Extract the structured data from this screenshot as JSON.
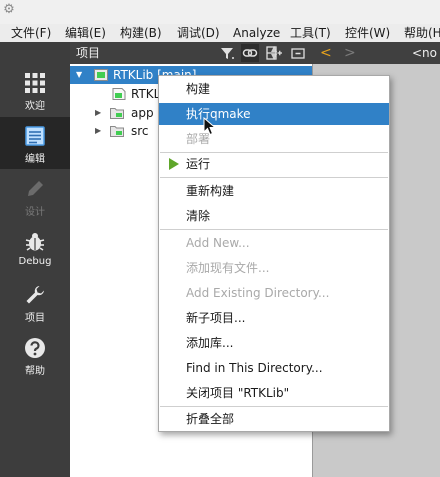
{
  "menubar": {
    "items": [
      "文件(F)",
      "编辑(E)",
      "构建(B)",
      "调试(D)",
      "Analyze",
      "工具(T)",
      "控件(W)",
      "帮助(H)"
    ]
  },
  "modes": [
    {
      "label": "欢迎",
      "icon": "grid-icon",
      "active": false,
      "enabled": true
    },
    {
      "label": "编辑",
      "icon": "document-icon",
      "active": true,
      "enabled": true
    },
    {
      "label": "设计",
      "icon": "pencil-icon",
      "active": false,
      "enabled": false
    },
    {
      "label": "Debug",
      "icon": "bug-icon",
      "active": false,
      "enabled": true
    },
    {
      "label": "项目",
      "icon": "wrench-icon",
      "active": false,
      "enabled": true
    },
    {
      "label": "帮助",
      "icon": "help-icon",
      "active": false,
      "enabled": true
    }
  ],
  "project_pane": {
    "title": "项目",
    "tree": [
      {
        "label": "RTKLib [main]",
        "expanded": true,
        "selected": true
      },
      {
        "label": "RTKLib.pro"
      },
      {
        "label": "app",
        "expanded": false
      },
      {
        "label": "src",
        "expanded": false
      }
    ]
  },
  "editor_bar": {
    "back_glyph": "<",
    "forward_glyph": ">",
    "document": "<no document>"
  },
  "context_menu": {
    "items": [
      {
        "label": "构建",
        "enabled": true
      },
      {
        "label": "执行qmake",
        "enabled": true,
        "highlighted": true
      },
      {
        "label": "部署",
        "enabled": false
      },
      {
        "label": "运行",
        "enabled": true,
        "icon": "run-icon"
      },
      {
        "label": "重新构建",
        "enabled": true
      },
      {
        "label": "清除",
        "enabled": true
      },
      {
        "label": "Add New...",
        "enabled": false
      },
      {
        "label": "添加现有文件...",
        "enabled": false
      },
      {
        "label": "Add Existing Directory...",
        "enabled": false
      },
      {
        "label": "新子项目...",
        "enabled": true
      },
      {
        "label": "添加库...",
        "enabled": true
      },
      {
        "label": "Find in This Directory...",
        "enabled": true
      },
      {
        "label": "关闭项目 \"RTKLib\"",
        "enabled": true
      },
      {
        "label": "折叠全部",
        "enabled": true
      }
    ]
  },
  "colors": {
    "selection": "#3081c7",
    "sidebar": "#3d3d3d",
    "run_green": "#5fa62a"
  }
}
